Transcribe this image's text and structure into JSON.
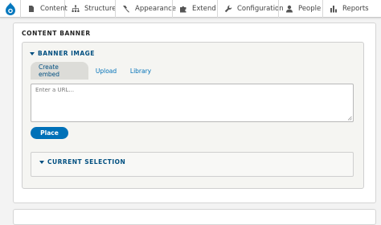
{
  "toolbar": {
    "items": [
      {
        "label": "Content",
        "icon": "page-icon"
      },
      {
        "label": "Structure",
        "icon": "sitemap-icon"
      },
      {
        "label": "Appearance",
        "icon": "paint-brush-icon"
      },
      {
        "label": "Extend",
        "icon": "puzzle-icon"
      },
      {
        "label": "Configuration",
        "icon": "wrench-icon"
      },
      {
        "label": "People",
        "icon": "person-icon"
      },
      {
        "label": "Reports",
        "icon": "bar-chart-icon"
      }
    ]
  },
  "content_banner": {
    "title": "CONTENT BANNER",
    "banner_image": {
      "title": "BANNER IMAGE",
      "tabs": [
        {
          "label": "Create embed",
          "active": true
        },
        {
          "label": "Upload",
          "active": false
        },
        {
          "label": "Library",
          "active": false
        }
      ],
      "url_placeholder": "Enter a URL...",
      "url_value": "",
      "place_label": "Place",
      "current_selection_title": "CURRENT SELECTION"
    }
  },
  "colors": {
    "accent": "#0071b8",
    "heading_blue": "#004f80",
    "active_tab_bg": "#dcdcd8"
  }
}
